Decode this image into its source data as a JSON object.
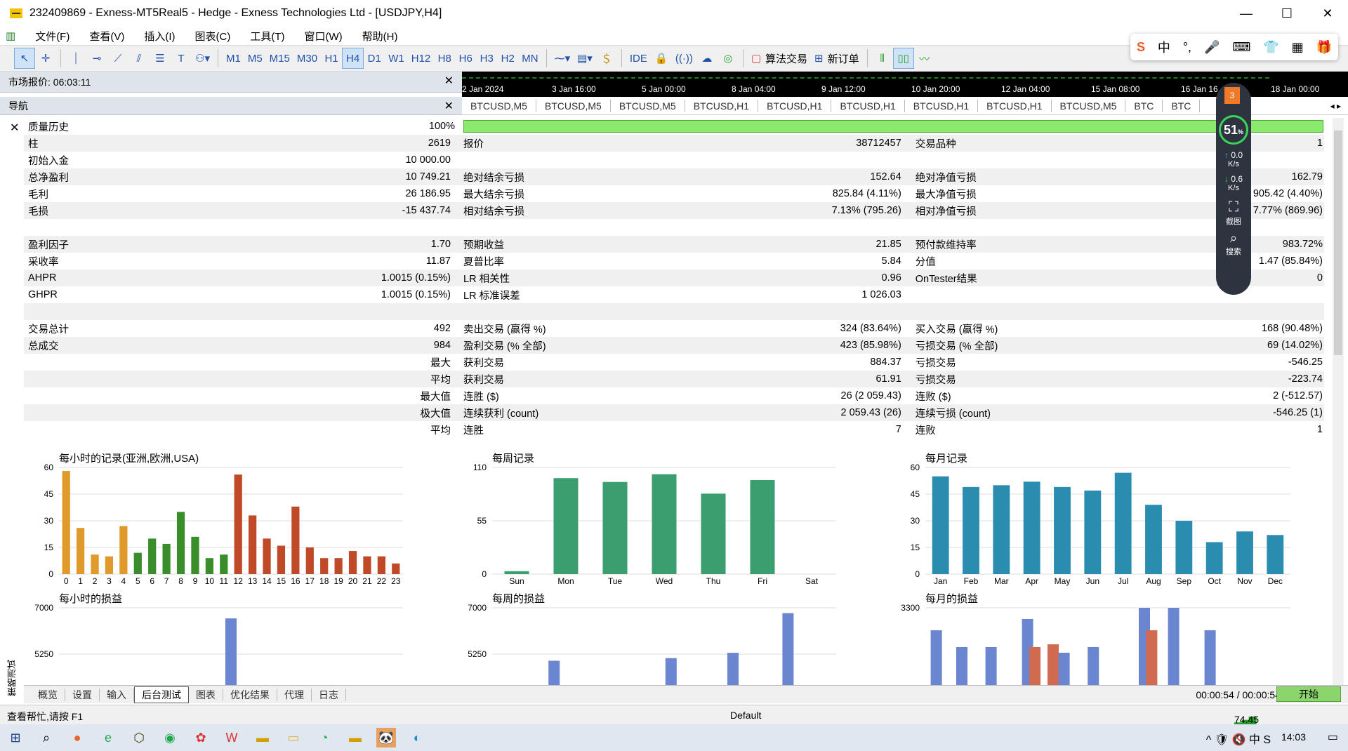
{
  "window": {
    "title": "232409869 - Exness-MT5Real5 - Hedge - Exness Technologies Ltd - [USDJPY,H4]",
    "minimize": "—",
    "maximize": "☐",
    "close": "✕"
  },
  "menu": [
    "文件(F)",
    "查看(V)",
    "插入(I)",
    "图表(C)",
    "工具(T)",
    "窗口(W)",
    "帮助(H)"
  ],
  "toolbar": {
    "timeframes": [
      "M1",
      "M5",
      "M15",
      "M30",
      "H1",
      "H4",
      "D1",
      "W1",
      "H12",
      "H8",
      "H6",
      "H3",
      "H2",
      "MN"
    ],
    "selected_timeframe": "H4",
    "ide": "IDE",
    "algo_trading": "算法交易",
    "new_order": "新订单"
  },
  "ime": {
    "items": [
      "S",
      "中",
      "°,",
      "🎤",
      "⌨",
      "👕",
      "▦",
      "🎁"
    ]
  },
  "market_watch": {
    "label": "市场报价: 06:03:11",
    "close": "✕"
  },
  "navigator": {
    "label": "导航",
    "close": "✕"
  },
  "timeline": {
    "ticks": [
      "2 Jan 2024",
      "3 Jan 16:00",
      "5 Jan 00:00",
      "8 Jan 04:00",
      "9 Jan 12:00",
      "10 Jan 20:00",
      "12 Jan 04:00",
      "15 Jan 08:00",
      "16 Jan 16",
      "18 Jan 00:00"
    ]
  },
  "chart_tabs": [
    "BTCUSD,M5",
    "BTCUSD,M5",
    "BTCUSD,M5",
    "BTCUSD,H1",
    "BTCUSD,H1",
    "BTCUSD,H1",
    "BTCUSD,H1",
    "BTCUSD,H1",
    "BTCUSD,M5",
    "BTC",
    "BTC"
  ],
  "report": {
    "rows": [
      {
        "l1": "质量历史",
        "v1": "100%",
        "bar": true
      },
      {
        "l1": "柱",
        "v1": "2619",
        "l2": "报价",
        "v2": "38712457",
        "l3": "交易品种",
        "v3": "1"
      },
      {
        "l1": "初始入金",
        "v1": "10 000.00"
      },
      {
        "l1": "总净盈利",
        "v1": "10 749.21",
        "l2": "绝对结余亏损",
        "v2": "152.64",
        "l3": "绝对净值亏损",
        "v3": "162.79"
      },
      {
        "l1": "毛利",
        "v1": "26 186.95",
        "l2": "最大结余亏损",
        "v2": "825.84 (4.11%)",
        "l3": "最大净值亏损",
        "v3": "905.42 (4.40%)"
      },
      {
        "l1": "毛损",
        "v1": "-15 437.74",
        "l2": "相对结余亏损",
        "v2": "7.13% (795.26)",
        "l3": "相对净值亏损",
        "v3": "7.77% (869.96)"
      },
      {},
      {
        "l1": "盈利因子",
        "v1": "1.70",
        "l2": "预期收益",
        "v2": "21.85",
        "l3": "预付款维持率",
        "v3": "983.72%"
      },
      {
        "l1": "采收率",
        "v1": "11.87",
        "l2": "夏普比率",
        "v2": "5.84",
        "l3": "分值",
        "v3": "1.47 (85.84%)"
      },
      {
        "l1": "AHPR",
        "v1": "1.0015 (0.15%)",
        "l2": "LR 相关性",
        "v2": "0.96",
        "l3": "OnTester结果",
        "v3": "0"
      },
      {
        "l1": "GHPR",
        "v1": "1.0015 (0.15%)",
        "l2": "LR 标准误差",
        "v2": "1 026.03"
      },
      {},
      {
        "l1": "交易总计",
        "v1": "492",
        "l2": "卖出交易 (赢得 %)",
        "v2": "324 (83.64%)",
        "l3": "买入交易 (赢得 %)",
        "v3": "168 (90.48%)"
      },
      {
        "l1": "总成交",
        "v1": "984",
        "l2": "盈利交易 (% 全部)",
        "v2": "423 (85.98%)",
        "l3": "亏损交易 (% 全部)",
        "v3": "69 (14.02%)"
      },
      {
        "v1": "最大",
        "l2": "获利交易",
        "v2": "884.37",
        "l3": "亏损交易",
        "v3": "-546.25"
      },
      {
        "v1": "平均",
        "l2": "获利交易",
        "v2": "61.91",
        "l3": "亏损交易",
        "v3": "-223.74"
      },
      {
        "v1": "最大值",
        "l2": "连胜 ($)",
        "v2": "26 (2 059.43)",
        "l3": "连败 ($)",
        "v3": "2 (-512.57)"
      },
      {
        "v1": "极大值",
        "l2": "连续获利 (count)",
        "v2": "2 059.43 (26)",
        "l3": "连续亏损 (count)",
        "v3": "-546.25 (1)"
      },
      {
        "v1": "平均",
        "l2": "连胜",
        "v2": "7",
        "l3": "连败",
        "v3": "1"
      }
    ]
  },
  "float_widget": {
    "badge": "3",
    "percent": "51",
    "pct_sign": "%",
    "up": "0.0",
    "up_unit": "K/s",
    "down": "0.6",
    "down_unit": "K/s",
    "screenshot": "截图",
    "search": "搜索"
  },
  "chart_data": [
    {
      "type": "bar",
      "title": "每小时的记录(亚洲,欧洲,USA)",
      "categories": [
        "0",
        "1",
        "2",
        "3",
        "4",
        "5",
        "6",
        "7",
        "8",
        "9",
        "10",
        "11",
        "12",
        "13",
        "14",
        "15",
        "16",
        "17",
        "18",
        "19",
        "20",
        "21",
        "22",
        "23"
      ],
      "values": [
        58,
        26,
        11,
        10,
        27,
        12,
        20,
        17,
        35,
        21,
        9,
        11,
        56,
        33,
        20,
        16,
        38,
        15,
        9,
        9,
        13,
        10,
        10,
        6
      ],
      "yticks": [
        "0",
        "15",
        "30",
        "45",
        "60"
      ],
      "ylim": [
        0,
        60
      ]
    },
    {
      "type": "bar",
      "title": "每周记录",
      "categories": [
        "Sun",
        "Mon",
        "Tue",
        "Wed",
        "Thu",
        "Fri",
        "Sat"
      ],
      "values": [
        3,
        99,
        95,
        103,
        83,
        97,
        0
      ],
      "yticks": [
        "0",
        "55",
        "110"
      ],
      "ylim": [
        0,
        110
      ]
    },
    {
      "type": "bar",
      "title": "每月记录",
      "categories": [
        "Jan",
        "Feb",
        "Mar",
        "Apr",
        "May",
        "Jun",
        "Jul",
        "Aug",
        "Sep",
        "Oct",
        "Nov",
        "Dec"
      ],
      "values": [
        55,
        49,
        50,
        52,
        49,
        47,
        57,
        39,
        30,
        18,
        24,
        22
      ],
      "yticks": [
        "0",
        "15",
        "30",
        "45",
        "60"
      ],
      "ylim": [
        0,
        60
      ]
    },
    {
      "type": "bar",
      "title": "每小时的损益",
      "yticks": [
        "7000",
        "5250",
        "3500"
      ],
      "ylim": [
        3500,
        7000
      ]
    },
    {
      "type": "bar",
      "title": "每周的损益",
      "yticks": [
        "7000",
        "5250",
        "3500"
      ],
      "ylim": [
        3500,
        7000
      ]
    },
    {
      "type": "bar",
      "title": "每月的损益",
      "yticks": [
        "3300",
        "1650"
      ],
      "ylim": [
        1650,
        3300
      ]
    }
  ],
  "bottom_tabs": [
    "概览",
    "设置",
    "输入",
    "后台测试",
    "图表",
    "优化结果",
    "代理",
    "日志"
  ],
  "active_bottom_tab": "后台测试",
  "timer": "00:00:54 / 00:00:54",
  "start_button": "开始",
  "vertical_label": "策略测试",
  "status": {
    "help": "查看帮忙,请按 F1",
    "profile": "Default",
    "ping": "74.45 ms"
  },
  "taskbar": {
    "time": "14:03"
  },
  "colors": {
    "quality_bar": "#8bea6e",
    "start_button": "#8bd56c",
    "weekly_bar": "#3a9e6e",
    "monthly_bar": "#2a8db0"
  }
}
